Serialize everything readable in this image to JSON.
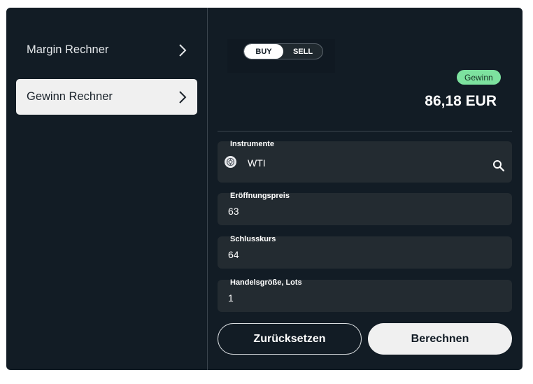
{
  "sidebar": {
    "items": [
      {
        "label": "Margin Rechner",
        "active": false
      },
      {
        "label": "Gewinn Rechner",
        "active": true
      }
    ]
  },
  "toggle": {
    "buy": "BUY",
    "sell": "SELL",
    "selected": "BUY"
  },
  "result": {
    "badge": "Gewinn",
    "value": "86,18 EUR",
    "badge_color": "#7de29f"
  },
  "fields": {
    "instrument": {
      "label": "Instrumente",
      "value": "WTI",
      "icon": "instrument-logo-icon",
      "action_icon": "search-icon"
    },
    "open_price": {
      "label": "Eröffnungspreis",
      "value": "63"
    },
    "close_price": {
      "label": "Schlusskurs",
      "value": "64"
    },
    "trade_size": {
      "label": "Handelsgröße, Lots",
      "value": "1"
    }
  },
  "buttons": {
    "reset": "Zurücksetzen",
    "calculate": "Berechnen"
  },
  "colors": {
    "panel": "#121c25",
    "field": "#232b31",
    "accent": "#7de29f"
  }
}
